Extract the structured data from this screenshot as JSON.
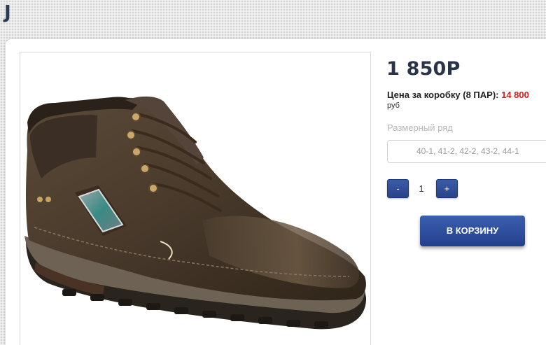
{
  "page": {
    "title": "J"
  },
  "product": {
    "image_alt_icon": "boot-image",
    "price": "1 850Р",
    "box_price_label": "Цена за коробку (8 ПАР):",
    "box_price_value": "14 800",
    "currency": "руб",
    "size_label": "Размерный ряд",
    "size_value": "40-1, 41-2, 42-2, 43-2, 44-1",
    "quantity": {
      "minus_label": "-",
      "value": "1",
      "plus_label": "+"
    },
    "add_to_cart_label": "В КОРЗИНУ"
  },
  "colors": {
    "accent": "#2d4a94",
    "price_red": "#d1201e",
    "title": "#2b3a55"
  }
}
